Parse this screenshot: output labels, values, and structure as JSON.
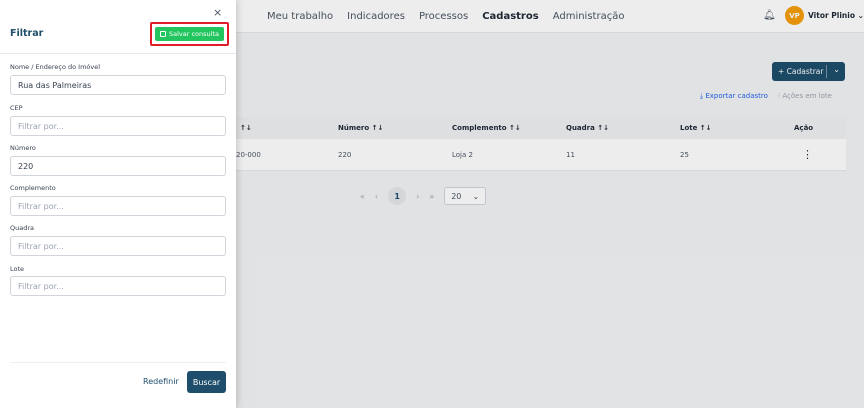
{
  "nav": {
    "items": [
      "Meu trabalho",
      "Indicadores",
      "Processos",
      "Cadastros",
      "Administração"
    ],
    "active": "Cadastros"
  },
  "user": {
    "initials": "VP",
    "name": "Vitor Plinio"
  },
  "actions": {
    "cadastrar": "+ Cadastrar",
    "exportar": "Exportar cadastro",
    "acoes_lote": "Ações em lote"
  },
  "table": {
    "columns": [
      "↑↓",
      "Número ↑↓",
      "Complemento ↑↓",
      "Quadra ↑↓",
      "Lote ↑↓",
      "Ação"
    ],
    "rows": [
      [
        "20-000",
        "220",
        "Loja 2",
        "11",
        "25",
        "⋮"
      ]
    ]
  },
  "pagination": {
    "first": "«",
    "prev": "‹",
    "current": "1",
    "next": "›",
    "last": "»",
    "page_size": "20"
  },
  "filter": {
    "title": "Filtrar",
    "close": "×",
    "save_label": "Salvar consulta",
    "fields": [
      {
        "label": "Nome / Endereço do Imóvel",
        "value": "Rua das Palmeiras",
        "placeholder": ""
      },
      {
        "label": "CEP",
        "value": "",
        "placeholder": "Filtrar por..."
      },
      {
        "label": "Número",
        "value": "220",
        "placeholder": ""
      },
      {
        "label": "Complemento",
        "value": "",
        "placeholder": "Filtrar por..."
      },
      {
        "label": "Quadra",
        "value": "",
        "placeholder": "Filtrar por..."
      },
      {
        "label": "Lote",
        "value": "",
        "placeholder": "Filtrar por..."
      }
    ],
    "reset_label": "Redefinir",
    "search_label": "Buscar"
  },
  "colors": {
    "primary": "#1e4e6b",
    "save": "#22c55e",
    "highlight": "#e11d2a",
    "avatar": "#f59e0b"
  },
  "icons": [
    "close-icon",
    "save-icon",
    "bell-icon",
    "chevron-down-icon",
    "sort-icon",
    "kebab-icon",
    "download-icon"
  ]
}
